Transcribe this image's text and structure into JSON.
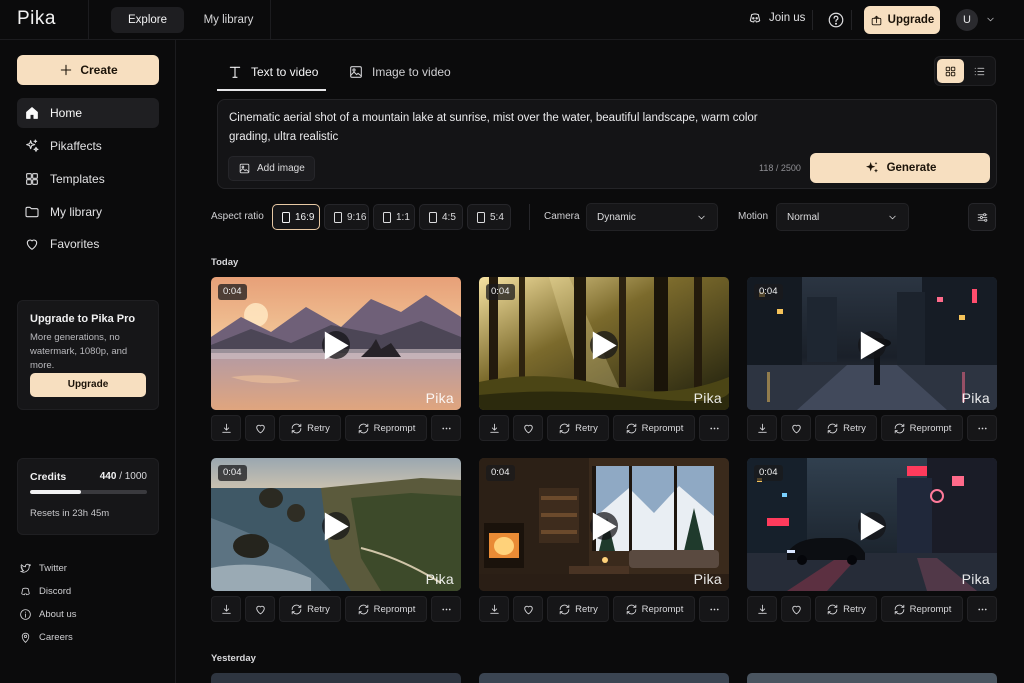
{
  "topbar": {
    "logo": "Pika",
    "nav": [
      "Explore",
      "My library"
    ],
    "join_us": "Join us",
    "upgrade": "Upgrade",
    "avatar_initial": "U"
  },
  "sidebar": {
    "create": "Create",
    "items": [
      {
        "label": "Home",
        "icon": "home-icon"
      },
      {
        "label": "Pikaffects",
        "icon": "sparkle-icon"
      },
      {
        "label": "Templates",
        "icon": "grid-icon"
      },
      {
        "label": "My library",
        "icon": "folder-icon"
      },
      {
        "label": "Favorites",
        "icon": "heart-icon"
      }
    ],
    "promo": {
      "title": "Upgrade to Pika Pro",
      "desc": "More generations, no watermark, 1080p, and more.",
      "button": "Upgrade"
    },
    "credits": {
      "label": "Credits",
      "used": "440",
      "total": "/ 1000",
      "progress": 0.44,
      "reset": "Resets in 23h 45m"
    },
    "footer": [
      "Twitter",
      "Discord",
      "About us",
      "Careers"
    ]
  },
  "main": {
    "tabs": [
      "Text to video",
      "Image to video"
    ],
    "prompt": "Cinematic aerial shot of a mountain lake at sunrise, mist over the water, beautiful landscape, warm color grading, ultra realistic",
    "add_image": "Add image",
    "char_count": "118 / 2500",
    "generate": "Generate",
    "options": {
      "aspect_label": "Aspect ratio",
      "aspect_ratios": [
        "16:9",
        "9:16",
        "1:1",
        "4:5",
        "5:4"
      ],
      "camera_label": "Camera",
      "camera_value": "Dynamic",
      "motion_label": "Motion",
      "motion_value": "Normal"
    },
    "sections": [
      "Today",
      "Yesterday"
    ],
    "actions": {
      "retry": "Retry",
      "reprompt": "Reprompt"
    },
    "cards": [
      {
        "duration": "0:04",
        "watermark": "Pika",
        "scene": "mountain-lake-sunrise"
      },
      {
        "duration": "0:04",
        "watermark": "Pika",
        "scene": "forest-sunbeams"
      },
      {
        "duration": "0:04",
        "watermark": "Pika",
        "scene": "rainy-city-night"
      },
      {
        "duration": "0:04",
        "watermark": "Pika",
        "scene": "coastal-cliffs"
      },
      {
        "duration": "0:04",
        "watermark": "Pika",
        "scene": "cozy-cabin-fireplace"
      },
      {
        "duration": "0:04",
        "watermark": "Pika",
        "scene": "neon-city-car"
      }
    ]
  },
  "colors": {
    "accent": "#f7dfc0",
    "background": "#0b0b0c",
    "panel": "#161618"
  }
}
